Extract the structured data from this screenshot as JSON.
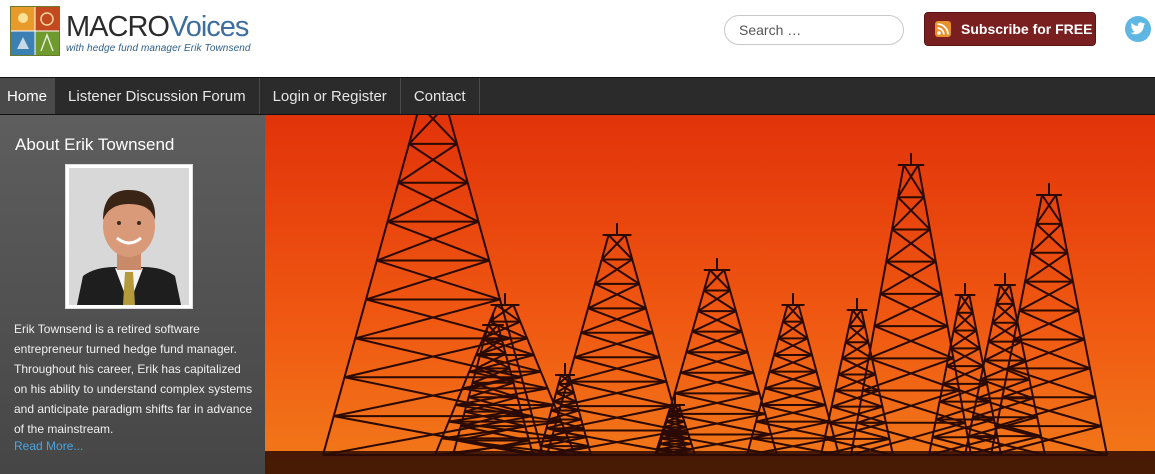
{
  "header": {
    "logo": {
      "title_part1": "MACRO",
      "title_part2": "Voices",
      "tagline": "with hedge fund manager Erik Townsend",
      "icon": "macrovoices-logo-icon"
    },
    "search": {
      "placeholder": "Search …",
      "value": ""
    },
    "subscribe": {
      "label": "Subscribe for FREE",
      "icon": "rss-icon",
      "color": "#7a1f1f"
    },
    "social": {
      "icon": "twitter-icon",
      "color": "#5fb6e2"
    }
  },
  "nav": {
    "items": [
      {
        "label": "Home",
        "active": true
      },
      {
        "label": "Listener Discussion Forum",
        "active": false
      },
      {
        "label": "Login or Register",
        "active": false
      },
      {
        "label": "Contact",
        "active": false
      }
    ]
  },
  "sidebar": {
    "title": "About Erik Townsend",
    "photo": "erik-townsend-portrait",
    "bio": "Erik Townsend is a retired software entrepreneur turned hedge fund manager. Throughout his career, Erik has capitalized on his ability to understand complex systems and anticipate paradigm shifts far in advance of the mainstream.",
    "read_more": "Read More..."
  },
  "hero": {
    "image": "oil-derricks-sunset-image",
    "colors": {
      "sky_top": "#e8380b",
      "sky_bottom": "#f06a14",
      "silhouette": "#2a0a02"
    }
  }
}
